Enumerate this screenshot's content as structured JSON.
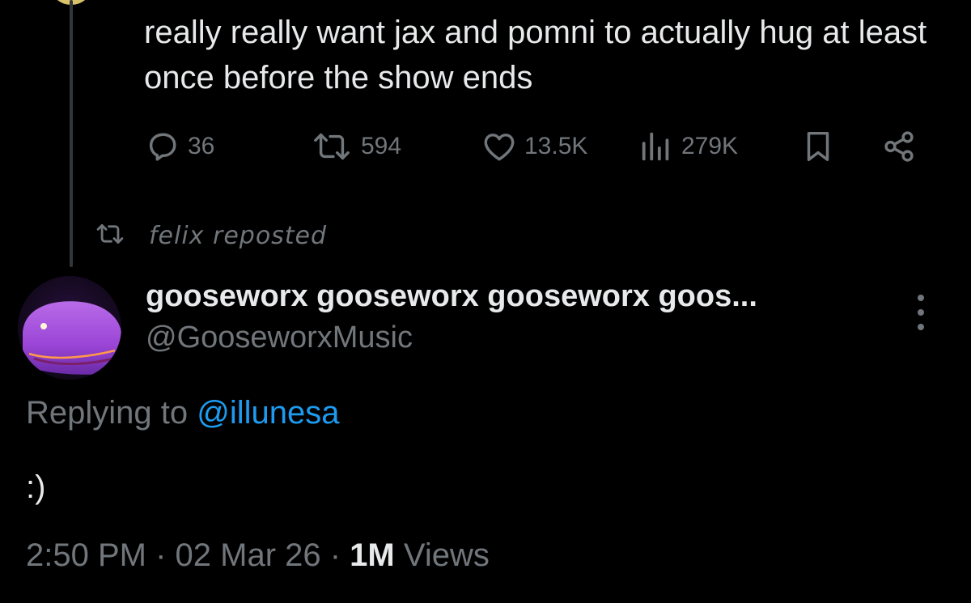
{
  "parent_tweet": {
    "text": "really really want jax and pomni to actually hug at least once before the show ends",
    "replies": "36",
    "reposts": "594",
    "likes": "13.5K",
    "views": "279K"
  },
  "repost_notice": {
    "label": "felix reposted",
    "icon": "repost-icon"
  },
  "reply_tweet": {
    "display_name": "gooseworx gooseworx gooseworx goos...",
    "handle": "@GooseworxMusic",
    "replying_prefix": "Replying to ",
    "replying_to": "@illunesa",
    "text": ":)",
    "time": "2:50 PM",
    "separator": " · ",
    "date": "02 Mar 26",
    "views_count": "1M",
    "views_label": " Views"
  },
  "icons": [
    "reply-icon",
    "repost-icon",
    "like-icon",
    "views-icon",
    "bookmark-icon",
    "share-icon",
    "more-options-icon"
  ],
  "colors": {
    "background": "#000000",
    "primary_text": "#e7e9ea",
    "secondary_text": "#71767b",
    "link": "#1d9bf0",
    "thread_line": "#333639"
  }
}
